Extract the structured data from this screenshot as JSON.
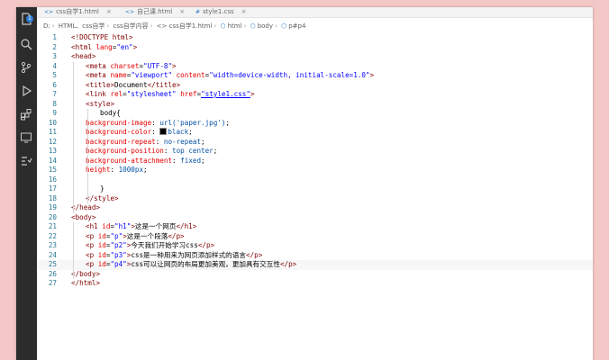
{
  "tabs": [
    {
      "icon": "<>",
      "label": "css自学1.html",
      "close": "×"
    },
    {
      "icon": "<>",
      "label": "自己课.html",
      "close": "×"
    },
    {
      "icon": "#",
      "label": "style1.css",
      "close": "×"
    }
  ],
  "activity_badge": "1",
  "breadcrumb": [
    "D:",
    "HTML、css自学",
    "css自学内容",
    "<> css自学1.html",
    "html",
    "body",
    "p#p4"
  ],
  "code_lines": [
    {
      "n": "1",
      "text": "<!DOCTYPE html>"
    },
    {
      "n": "2",
      "text": "<html lang=\"en\">"
    },
    {
      "n": "3",
      "text": "<head>"
    },
    {
      "n": "4",
      "text": "<meta charset=\"UTF-8\">"
    },
    {
      "n": "5",
      "text": "<meta name=\"viewport\" content=\"width=device-width, initial-scale=1.0\">"
    },
    {
      "n": "6",
      "text": "<title>Document</title>"
    },
    {
      "n": "7",
      "text": "<link rel=\"stylesheet\" href=\"style1.css\">"
    },
    {
      "n": "8",
      "text": "<style>"
    },
    {
      "n": "9",
      "text": "body{"
    },
    {
      "n": "10",
      "text": "background-image: url('paper.jpg');"
    },
    {
      "n": "11",
      "text": "background-color: black;"
    },
    {
      "n": "12",
      "text": "background-repeat: no-repeat;"
    },
    {
      "n": "13",
      "text": "background-position: top center;"
    },
    {
      "n": "14",
      "text": "background-attachment: fixed;"
    },
    {
      "n": "15",
      "text": "height: 1000px;"
    },
    {
      "n": "16",
      "text": ""
    },
    {
      "n": "17",
      "text": "}"
    },
    {
      "n": "18",
      "text": "</style>"
    },
    {
      "n": "19",
      "text": "</head>"
    },
    {
      "n": "20",
      "text": "<body>"
    },
    {
      "n": "21",
      "text": "<h1 id=\"h1\">这是一个网页</h1>"
    },
    {
      "n": "22",
      "text": "<p id=\"p\">这是一个段落</p>"
    },
    {
      "n": "23",
      "text": "<p id=\"p2\">今天我们开始学习css</p>"
    },
    {
      "n": "24",
      "text": "<p id=\"p3\">css是一种用来为网页添加样式的语言</p>"
    },
    {
      "n": "25",
      "text": "<p id=\"p4\">css可以让网页的布局更加美观，更加具有交互性</p>"
    },
    {
      "n": "26",
      "text": "</body>"
    },
    {
      "n": "27",
      "text": "</html>"
    }
  ]
}
